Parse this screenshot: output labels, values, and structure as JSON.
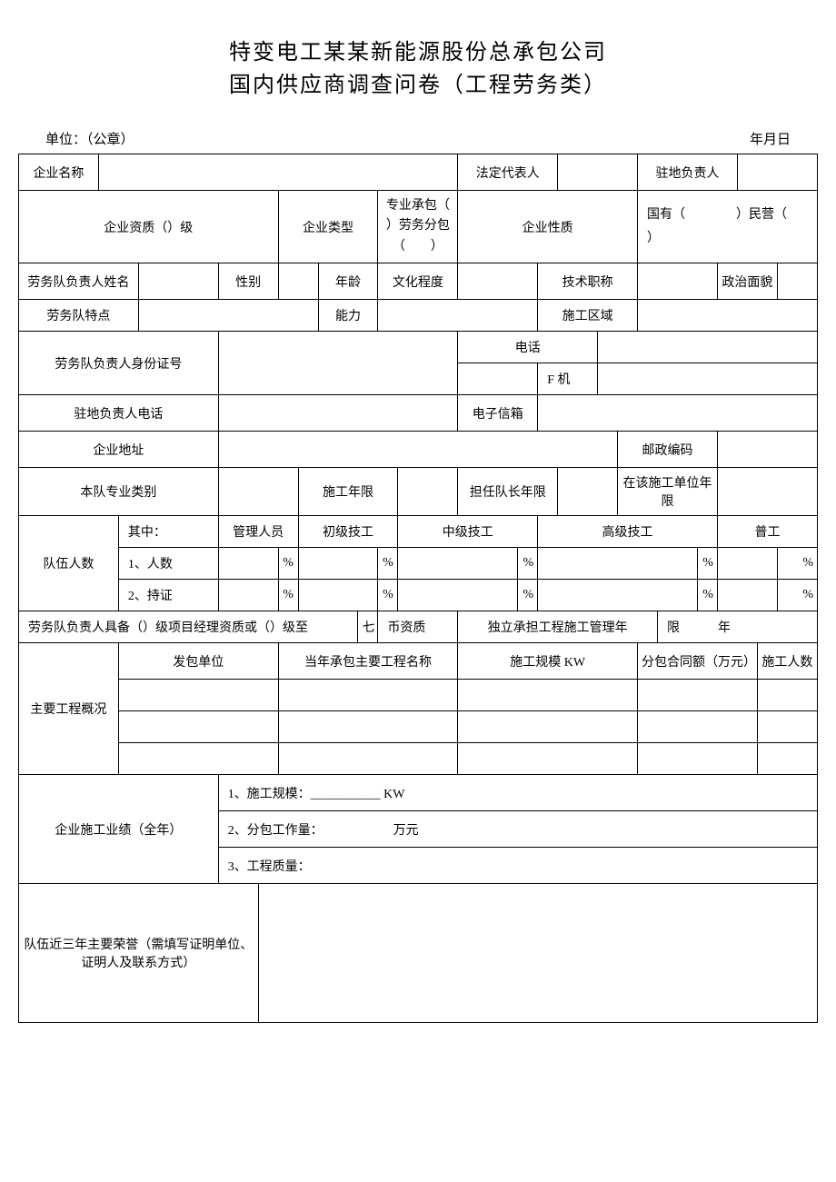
{
  "title_line1": "特变电工某某新能源股份总承包公司",
  "title_line2": "国内供应商调查问卷（工程劳务类）",
  "header_unit": "单位：（公章）",
  "header_date": "年月日",
  "labels": {
    "company_name": "企业名称",
    "legal_rep": "法定代表人",
    "local_head": "驻地负责人",
    "qualification": "企业资质（）级",
    "company_type": "企业类型",
    "type_options": "专业承包（　　）劳务分包（　　）",
    "company_nature": "企业性质",
    "nature_options": "国有（　　　　）民营（　　　　）",
    "leader_name": "劳务队负责人姓名",
    "gender": "性别",
    "age": "年龄",
    "education": "文化程度",
    "tech_title": "技术职称",
    "political": "政治面貌",
    "team_feature": "劳务队特点",
    "ability": "能力",
    "area": "施工区域",
    "leader_id": "劳务队负责人身份证号",
    "phone": "电话",
    "fax": "F 机",
    "local_phone": "驻地负责人电话",
    "email": "电子信箱",
    "address": "企业地址",
    "postcode": "邮政编码",
    "specialty": "本队专业类别",
    "years": "施工年限",
    "leader_years": "担任队长年限",
    "unit_years": "在该施工单位年限",
    "team_count": "队伍人数",
    "of_which": "其中：",
    "mgmt": "管理人员",
    "junior": "初级技工",
    "mid": "中级技工",
    "senior": "高级技工",
    "general": "普工",
    "row_people": "1、人数",
    "row_cert": "2、持证",
    "pct": "%",
    "pm_qual": "劳务队负责人具备（）级项目经理资质或（）级至",
    "pm_qual2": "七",
    "pm_qual3": "币资质",
    "indep": "独立承担工程施工管理年",
    "indep2": "限　　　年",
    "proj_overview": "主要工程概况",
    "contractor": "发包单位",
    "proj_name": "当年承包主要工程名称",
    "scale": "施工规模 KW",
    "amount": "分包合同额（万元）",
    "workers": "施工人数",
    "annual": "企业施工业绩（全年）",
    "a1": "1、施工规模：___________ KW",
    "a2": "2、分包工作量：　　　　　　万元",
    "a3": "3、工程质量：",
    "honors": "队伍近三年主要荣誉（需填写证明单位、证明人及联系方式）"
  }
}
